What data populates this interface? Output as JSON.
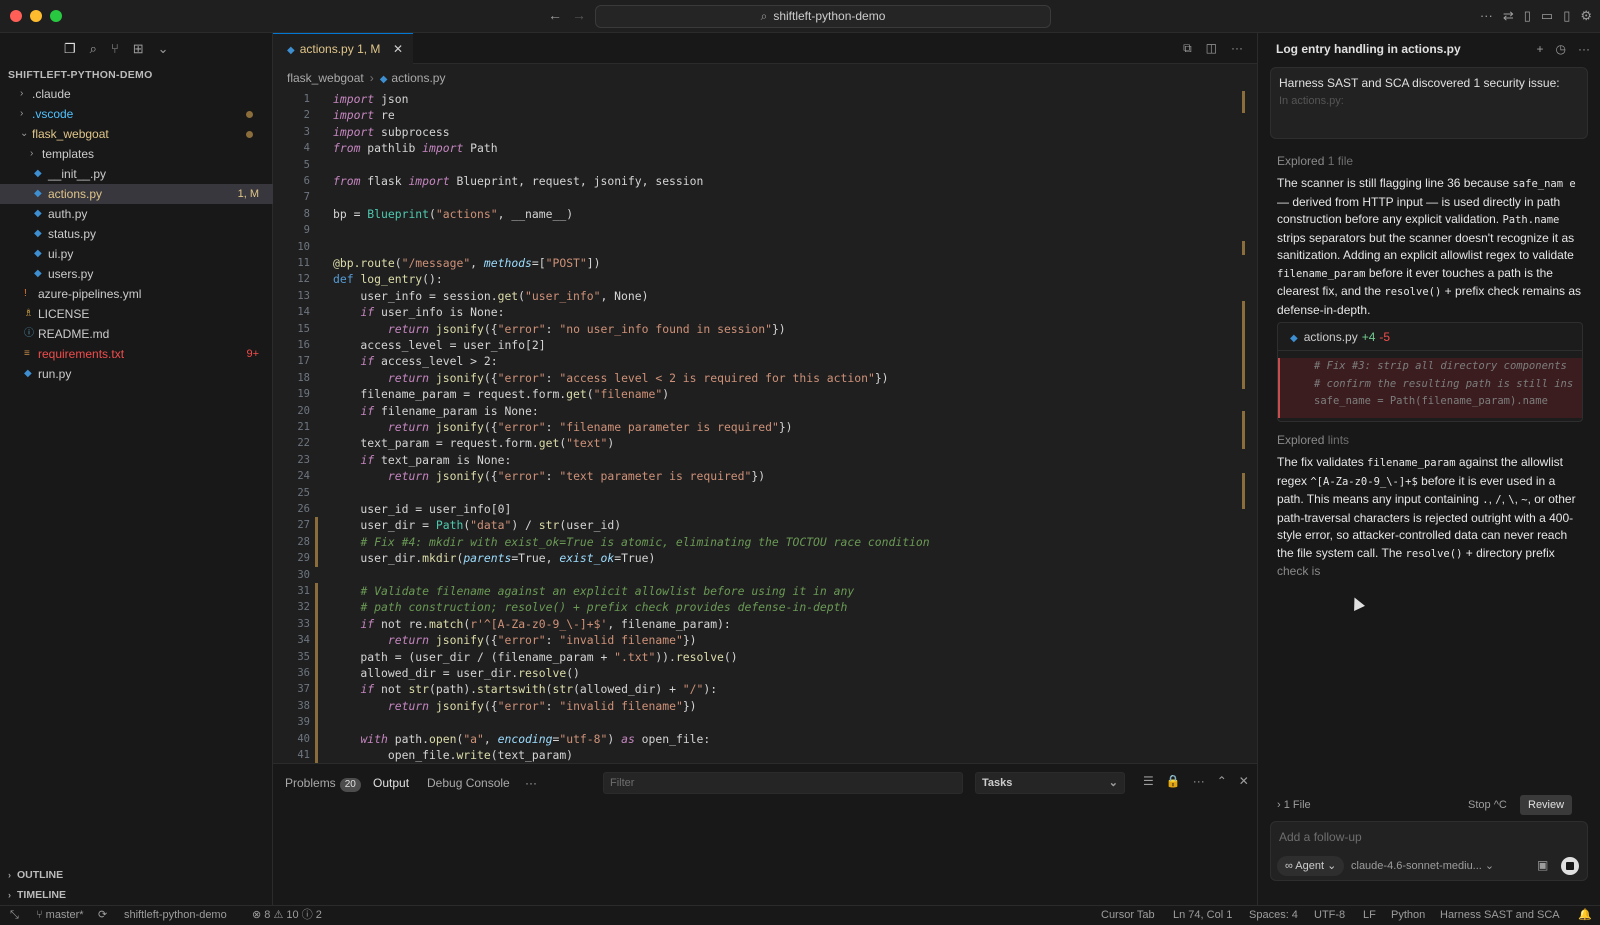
{
  "window": {
    "search_text": "shiftleft-python-demo"
  },
  "sidebar": {
    "title": "SHIFTLEFT-PYTHON-DEMO",
    "items": [
      {
        "label": ".claude",
        "type": "folder",
        "open": false,
        "indent": 0
      },
      {
        "label": ".vscode",
        "type": "folder",
        "open": false,
        "indent": 0,
        "color": "#4fc1ff"
      },
      {
        "label": "flask_webgoat",
        "type": "folder",
        "open": true,
        "indent": 0,
        "color": "#e0c58a"
      },
      {
        "label": "templates",
        "type": "folder",
        "open": false,
        "indent": 1
      },
      {
        "label": "__init__.py",
        "type": "py",
        "indent": 1
      },
      {
        "label": "actions.py",
        "type": "py",
        "indent": 1,
        "badge": "1, M",
        "color": "#e0c58a",
        "selected": true
      },
      {
        "label": "auth.py",
        "type": "py",
        "indent": 1
      },
      {
        "label": "status.py",
        "type": "py",
        "indent": 1
      },
      {
        "label": "ui.py",
        "type": "py",
        "indent": 1
      },
      {
        "label": "users.py",
        "type": "py",
        "indent": 1
      },
      {
        "label": "azure-pipelines.yml",
        "type": "yml",
        "indent": 0
      },
      {
        "label": "LICENSE",
        "type": "license",
        "indent": 0
      },
      {
        "label": "README.md",
        "type": "md",
        "indent": 0
      },
      {
        "label": "requirements.txt",
        "type": "txt",
        "indent": 0,
        "badge": "9+",
        "color": "#f14c4c"
      },
      {
        "label": "run.py",
        "type": "py",
        "indent": 0
      }
    ],
    "outline_label": "OUTLINE",
    "timeline_label": "TIMELINE"
  },
  "editor": {
    "tab_name": "actions.py",
    "tab_badge": "1, M",
    "breadcrumb": [
      "flask_webgoat",
      "actions.py"
    ],
    "lines": [
      "<span class=\"k\">import</span> json",
      "<span class=\"k\">import</span> re",
      "<span class=\"k\">import</span> subprocess",
      "<span class=\"k\">from</span> pathlib <span class=\"k\">import</span> Path",
      "",
      "<span class=\"k\">from</span> flask <span class=\"k\">import</span> Blueprint, request, jsonify, session",
      "",
      "bp = <span class=\"cl\">Blueprint</span>(<span class=\"s\">\"actions\"</span>, __name__)",
      "",
      "",
      "<span class=\"f\">@bp.route</span>(<span class=\"s\">\"/message\"</span>, <span class=\"p\">methods</span>=[<span class=\"s\">\"POST\"</span>])",
      "<span class=\"kw\">def</span> <span class=\"f\">log_entry</span>():",
      "    user_info = session.<span class=\"f\">get</span>(<span class=\"s\">\"user_info\"</span>, None)",
      "    <span class=\"k\">if</span> user_info is None:",
      "        <span class=\"k\">return</span> <span class=\"f\">jsonify</span>({<span class=\"s\">\"error\"</span>: <span class=\"s\">\"no user_info found in session\"</span>})",
      "    access_level = user_info[2]",
      "    <span class=\"k\">if</span> access_level &gt; 2:",
      "        <span class=\"k\">return</span> <span class=\"f\">jsonify</span>({<span class=\"s\">\"error\"</span>: <span class=\"s\">\"access level &lt; 2 is required for this action\"</span>})",
      "    filename_param = request.form.<span class=\"f\">get</span>(<span class=\"s\">\"filename\"</span>)",
      "    <span class=\"k\">if</span> filename_param is None:",
      "        <span class=\"k\">return</span> <span class=\"f\">jsonify</span>({<span class=\"s\">\"error\"</span>: <span class=\"s\">\"filename parameter is required\"</span>})",
      "    text_param = request.form.<span class=\"f\">get</span>(<span class=\"s\">\"text\"</span>)",
      "    <span class=\"k\">if</span> text_param is None:",
      "        <span class=\"k\">return</span> <span class=\"f\">jsonify</span>({<span class=\"s\">\"error\"</span>: <span class=\"s\">\"text parameter is required\"</span>})",
      "",
      "    user_id = user_info[0]",
      "    user_dir = <span class=\"cl\">Path</span>(<span class=\"s\">\"data\"</span>) / <span class=\"f\">str</span>(user_id)",
      "    <span class=\"cm\"># Fix #4: mkdir with exist_ok=True is atomic, eliminating the TOCTOU race condition</span>",
      "    user_dir.<span class=\"f\">mkdir</span>(<span class=\"p\">parents</span>=True, <span class=\"p\">exist_ok</span>=True)",
      "",
      "    <span class=\"cm\"># Validate filename against an explicit allowlist before using it in any</span>",
      "    <span class=\"cm\"># path construction; resolve() + prefix check provides defense-in-depth</span>",
      "    <span class=\"k\">if</span> not re.<span class=\"f\">match</span>(<span class=\"s\">r'^[A-Za-z0-9_\\-]+$'</span>, filename_param):",
      "        <span class=\"k\">return</span> <span class=\"f\">jsonify</span>({<span class=\"s\">\"error\"</span>: <span class=\"s\">\"invalid filename\"</span>})",
      "    path = (user_dir / (filename_param + <span class=\"s\">\".txt\"</span>)).<span class=\"f\">resolve</span>()",
      "    allowed_dir = user_dir.<span class=\"f\">resolve</span>()",
      "    <span class=\"k\">if</span> not <span class=\"f\">str</span>(path).<span class=\"f\">startswith</span>(<span class=\"f\">str</span>(allowed_dir) + <span class=\"s\">\"/\"</span>):",
      "        <span class=\"k\">return</span> <span class=\"f\">jsonify</span>({<span class=\"s\">\"error\"</span>: <span class=\"s\">\"invalid filename\"</span>})",
      "",
      "    <span class=\"k\">with</span> path.<span class=\"f\">open</span>(<span class=\"s\">\"a\"</span>, <span class=\"p\">encoding</span>=<span class=\"s\">\"utf-8\"</span>) <span class=\"k\">as</span> open_file:",
      "        open_file.<span class=\"f\">write</span>(text_param)"
    ]
  },
  "panel": {
    "problems_label": "Problems",
    "problems_count": "20",
    "output_label": "Output",
    "debug_label": "Debug Console",
    "more_label": "···",
    "filter_placeholder": "Filter",
    "tasks_value": "Tasks"
  },
  "chat": {
    "title": "Log entry handling in actions.py",
    "quote": "Harness SAST and SCA discovered 1 security issue:",
    "quote_fade": "In actions.py:",
    "explored1_a": "Explored",
    "explored1_b": "1 file",
    "para1": "The scanner is still flagging line 36 because <code>safe_nam e</code> — derived from HTTP input — is used directly in path construction before any explicit validation. <code>Path.name</code> strips separators but the scanner doesn't recognize it as sanitization. Adding an explicit allowlist regex to validate <code>filename_param</code> before it ever touches a path is the clearest fix, and the <code>resolve()</code> + prefix check remains as defense-in-depth.",
    "diff_file": "actions.py",
    "diff_add": "+4",
    "diff_del": "-5",
    "diff_lines": [
      "# Fix #3: strip all directory components",
      "# confirm the resulting path is still ins",
      "safe_name = Path(filename_param).name"
    ],
    "explored2_a": "Explored",
    "explored2_b": "lints",
    "para2": "The fix validates <code>filename_param</code> against the allowlist regex <code>^[A-Za-z0-9_\\-]+$</code> before it is ever used in a path. This means any input containing <code>.</code>, <code>/</code>, <code>\\</code>, <code>~</code>, or other path-traversal characters is rejected outright with a 400-style error, so attacker-controlled data can never reach the file system call. The <code>resolve()</code> + directory prefix <span class=\"dim\">check is</span>",
    "files_label": "1 File",
    "stop_label": "Stop",
    "stop_shortcut": "^C",
    "review_label": "Review",
    "followup_placeholder": "Add a follow-up",
    "agent_label": "Agent",
    "model_label": "claude-4.6-sonnet-mediu..."
  },
  "status": {
    "branch": "master*",
    "project": "shiftleft-python-demo",
    "errors": "8",
    "warnings": "10",
    "infos": "2",
    "cursor_tab": "Cursor Tab",
    "position": "Ln 74, Col 1",
    "spaces": "Spaces: 4",
    "encoding": "UTF-8",
    "eol": "LF",
    "language": "Python",
    "extension": "Harness SAST and SCA"
  }
}
